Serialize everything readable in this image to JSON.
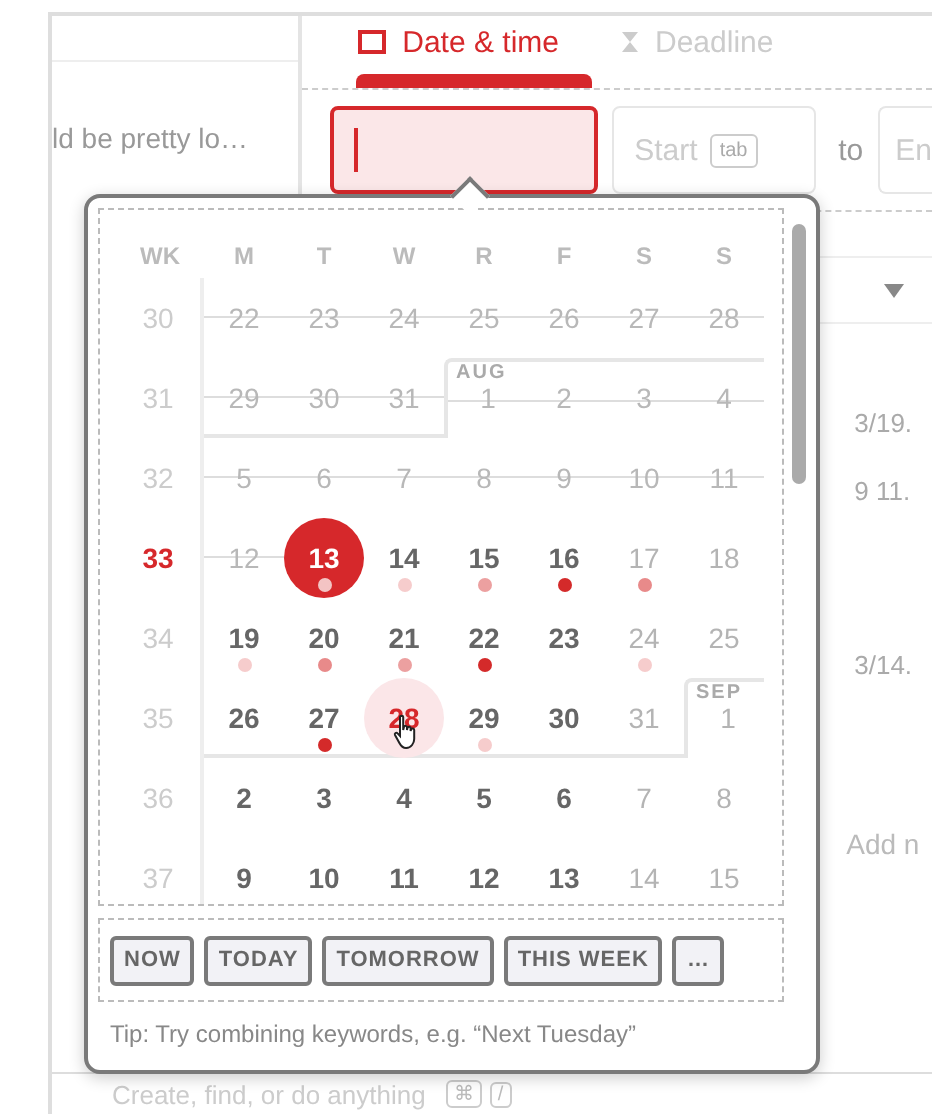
{
  "background": {
    "tabs": [
      {
        "label": "Date & time",
        "selected": true
      },
      {
        "label": "Deadline",
        "selected": false
      }
    ],
    "left_snippet": "ld be pretty lo…",
    "date_input": {
      "focused": true
    },
    "start_field": {
      "placeholder": "Start",
      "key_hint": "tab"
    },
    "to_label": "to",
    "end_field": {
      "placeholder": "En"
    },
    "right_cells": [
      "3/19.",
      "9 11.",
      "3/14."
    ],
    "add_note": "Add n",
    "command_bar": {
      "placeholder": "Create, find, or do anything",
      "keys": [
        "⌘",
        "/"
      ]
    }
  },
  "calendar": {
    "headers": [
      "WK",
      "M",
      "T",
      "W",
      "R",
      "F",
      "S",
      "S"
    ],
    "weeks": [
      {
        "wk": "30",
        "current": false,
        "days": [
          {
            "d": "22",
            "kind": "past"
          },
          {
            "d": "23",
            "kind": "past"
          },
          {
            "d": "24",
            "kind": "past"
          },
          {
            "d": "25",
            "kind": "past"
          },
          {
            "d": "26",
            "kind": "past"
          },
          {
            "d": "27",
            "kind": "past"
          },
          {
            "d": "28",
            "kind": "past"
          }
        ]
      },
      {
        "wk": "31",
        "current": false,
        "days": [
          {
            "d": "29",
            "kind": "past"
          },
          {
            "d": "30",
            "kind": "past"
          },
          {
            "d": "31",
            "kind": "past"
          },
          {
            "d": "1",
            "kind": "past",
            "month": "AUG"
          },
          {
            "d": "2",
            "kind": "past"
          },
          {
            "d": "3",
            "kind": "past"
          },
          {
            "d": "4",
            "kind": "past"
          }
        ]
      },
      {
        "wk": "32",
        "current": false,
        "days": [
          {
            "d": "5",
            "kind": "past"
          },
          {
            "d": "6",
            "kind": "past"
          },
          {
            "d": "7",
            "kind": "past"
          },
          {
            "d": "8",
            "kind": "past"
          },
          {
            "d": "9",
            "kind": "past"
          },
          {
            "d": "10",
            "kind": "past"
          },
          {
            "d": "11",
            "kind": "past"
          }
        ]
      },
      {
        "wk": "33",
        "current": true,
        "days": [
          {
            "d": "12",
            "kind": "past"
          },
          {
            "d": "13",
            "kind": "today",
            "color": "#f3c4c4"
          },
          {
            "d": "14",
            "kind": "normal",
            "color": "#f6cccc"
          },
          {
            "d": "15",
            "kind": "normal",
            "color": "#eca0a0"
          },
          {
            "d": "16",
            "kind": "normal",
            "color": "#d42a2a"
          },
          {
            "d": "17",
            "kind": "normal",
            "color": "#e88a8a"
          },
          {
            "d": "18",
            "kind": "normal"
          }
        ]
      },
      {
        "wk": "34",
        "current": false,
        "days": [
          {
            "d": "19",
            "kind": "normal",
            "color": "#f6cccc"
          },
          {
            "d": "20",
            "kind": "normal",
            "color": "#e88a8a"
          },
          {
            "d": "21",
            "kind": "normal",
            "color": "#eca0a0"
          },
          {
            "d": "22",
            "kind": "normal",
            "color": "#d42a2a"
          },
          {
            "d": "23",
            "kind": "normal"
          },
          {
            "d": "24",
            "kind": "normal",
            "color": "#f6cccc"
          },
          {
            "d": "25",
            "kind": "normal"
          }
        ]
      },
      {
        "wk": "35",
        "current": false,
        "days": [
          {
            "d": "26",
            "kind": "normal"
          },
          {
            "d": "27",
            "kind": "normal",
            "color": "#d42a2a"
          },
          {
            "d": "28",
            "kind": "hover"
          },
          {
            "d": "29",
            "kind": "normal",
            "color": "#f6cccc"
          },
          {
            "d": "30",
            "kind": "normal"
          },
          {
            "d": "31",
            "kind": "normal"
          },
          {
            "d": "1",
            "kind": "normal",
            "month": "SEP"
          }
        ]
      },
      {
        "wk": "36",
        "current": false,
        "days": [
          {
            "d": "2",
            "kind": "normal"
          },
          {
            "d": "3",
            "kind": "normal"
          },
          {
            "d": "4",
            "kind": "normal"
          },
          {
            "d": "5",
            "kind": "normal"
          },
          {
            "d": "6",
            "kind": "normal"
          },
          {
            "d": "7",
            "kind": "normal"
          },
          {
            "d": "8",
            "kind": "normal"
          }
        ]
      },
      {
        "wk": "37",
        "current": false,
        "days": [
          {
            "d": "9",
            "kind": "normal"
          },
          {
            "d": "10",
            "kind": "normal"
          },
          {
            "d": "11",
            "kind": "normal"
          },
          {
            "d": "12",
            "kind": "normal"
          },
          {
            "d": "13",
            "kind": "normal"
          },
          {
            "d": "14",
            "kind": "normal"
          },
          {
            "d": "15",
            "kind": "normal"
          }
        ]
      }
    ]
  },
  "quick_buttons": [
    "NOW",
    "TODAY",
    "TOMORROW",
    "THIS WEEK",
    "…"
  ],
  "tip": "Tip: Try combining keywords, e.g. “Next Tuesday”"
}
